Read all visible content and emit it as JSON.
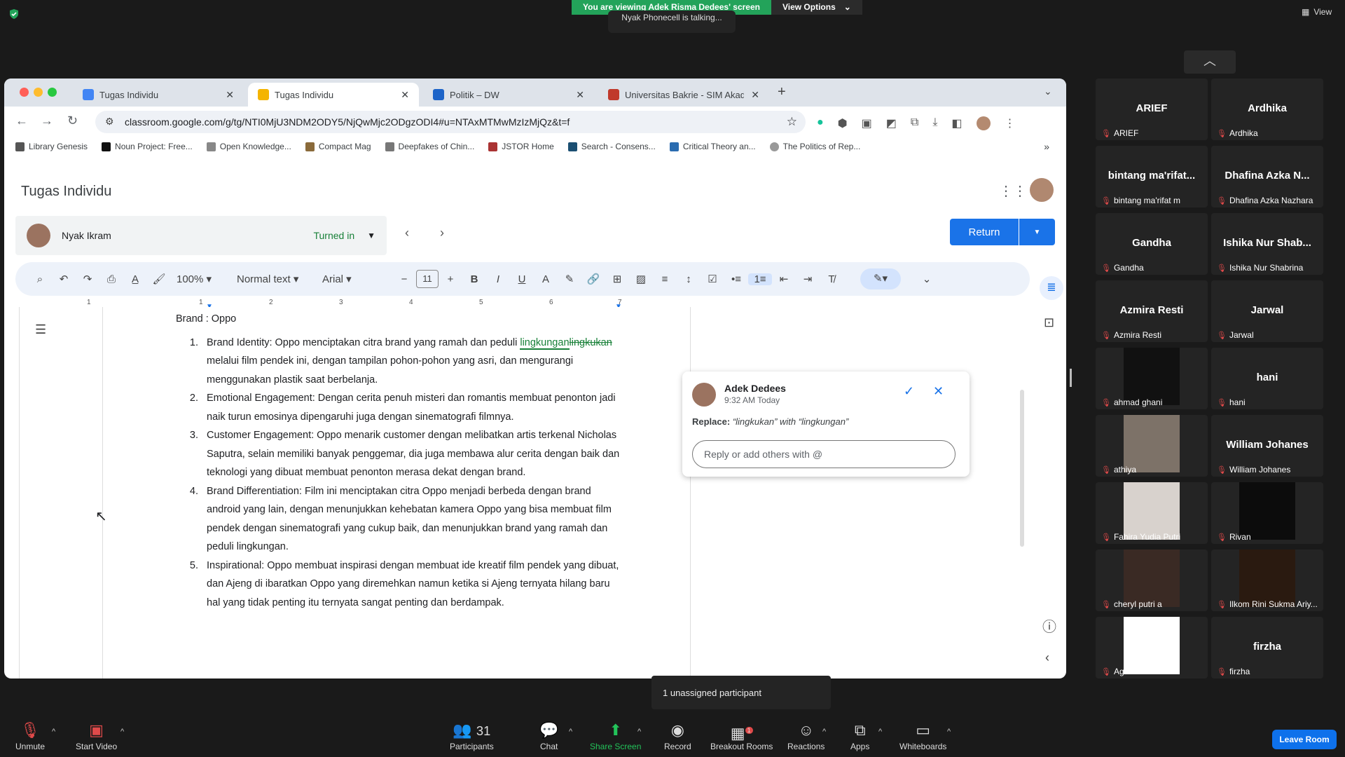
{
  "zoom": {
    "banner_text": "You are viewing Adek Risma Dedees' screen",
    "view_options": "View Options",
    "talking": "Nyak Phonecell is talking...",
    "view": "View",
    "unassigned": "1 unassigned participant",
    "leave": "Leave Room",
    "participants_count": "31",
    "breakout_badge": "1",
    "bottom": {
      "unmute": "Unmute",
      "start_video": "Start Video",
      "participants": "Participants",
      "chat": "Chat",
      "share": "Share Screen",
      "record": "Record",
      "breakout": "Breakout Rooms",
      "reactions": "Reactions",
      "apps": "Apps",
      "whiteboards": "Whiteboards"
    },
    "tiles": [
      {
        "name": "ARIEF",
        "label": "ARIEF",
        "video": false
      },
      {
        "name": "Ardhika",
        "label": "Ardhika",
        "video": false
      },
      {
        "name": "bintang  ma'rifat...",
        "label": "bintang ma'rifat m",
        "video": false
      },
      {
        "name": "Dhafina Azka N...",
        "label": "Dhafina Azka Nazhara",
        "video": false
      },
      {
        "name": "Gandha",
        "label": "Gandha",
        "video": false
      },
      {
        "name": "Ishika Nur Shab...",
        "label": "Ishika Nur Shabrina",
        "video": false
      },
      {
        "name": "Azmira Resti",
        "label": "Azmira Resti",
        "video": false
      },
      {
        "name": "Jarwal",
        "label": "Jarwal",
        "video": false
      },
      {
        "name": "",
        "label": "ahmad ghani",
        "video": true,
        "color": "#111"
      },
      {
        "name": "hani",
        "label": "hani",
        "video": false
      },
      {
        "name": "",
        "label": "athiya",
        "video": true,
        "color": "#7d7268"
      },
      {
        "name": "William Johanes",
        "label": "William Johanes",
        "video": false
      },
      {
        "name": "",
        "label": "Fahira Yudia Putri",
        "video": true,
        "color": "#d8d2cd"
      },
      {
        "name": "",
        "label": "Rivan",
        "video": true,
        "color": "#0c0c0c"
      },
      {
        "name": "",
        "label": "cheryl putri a",
        "video": true,
        "color": "#3a2a24"
      },
      {
        "name": "",
        "label": "Ilkom Rini Sukma Ariy...",
        "video": true,
        "color": "#2a1a10"
      },
      {
        "name": "",
        "label": "Agie Satria",
        "video": true,
        "color": "#ffffff"
      },
      {
        "name": "firzha",
        "label": "firzha",
        "video": false
      }
    ]
  },
  "browser": {
    "tabs": [
      {
        "label": "Tugas Individu",
        "color": "#4285f4"
      },
      {
        "label": "Tugas Individu",
        "color": "#f4b400"
      },
      {
        "label": "Politik – DW",
        "color": "#1d64c8"
      },
      {
        "label": "Universitas Bakrie - SIM Akad",
        "color": "#c0392b"
      }
    ],
    "url": "classroom.google.com/g/tg/NTI0MjU3NDM2ODY5/NjQwMjc2ODgzODI4#u=NTAxMTMwMzIzMjQz&t=f",
    "bookmarks": [
      "Library Genesis",
      "Noun Project: Free...",
      "Open Knowledge...",
      "Compact Mag",
      "Deepfakes of Chin...",
      "JSTOR Home",
      "Search - Consens...",
      "Critical Theory an...",
      "The Politics of Rep..."
    ]
  },
  "classroom": {
    "title": "Tugas Individu",
    "student": "Nyak Ikram",
    "status": "Turned in",
    "return": "Return"
  },
  "docs": {
    "zoom": "100%",
    "style": "Normal text",
    "font": "Arial",
    "size": "11",
    "ruler": [
      "1",
      "1",
      "2",
      "3",
      "4",
      "5",
      "6",
      "7"
    ],
    "heading": "Brand : Oppo",
    "items": [
      {
        "a": "Brand Identity: Oppo menciptakan citra brand yang ramah dan peduli ",
        "ins": "lingkungan",
        "del": "lingkukan",
        "b": " melalui film pendek ini, dengan tampilan pohon-pohon yang asri, dan mengurangi menggunakan plastik saat berbelanja."
      },
      {
        "a": "Emotional Engagement: Dengan cerita penuh misteri dan romantis membuat penonton jadi naik turun emosinya dipengaruhi juga dengan sinematografi filmnya."
      },
      {
        "a": "Customer Engagement: Oppo menarik customer dengan melibatkan artis terkenal Nicholas Saputra, selain memiliki banyak penggemar, dia juga membawa alur cerita dengan baik dan teknologi yang dibuat membuat penonton merasa dekat dengan brand."
      },
      {
        "a": "Brand Differentiation: Film ini menciptakan citra Oppo menjadi berbeda dengan brand android yang lain, dengan menunjukkan kehebatan kamera Oppo yang bisa membuat film pendek dengan sinematografi yang cukup baik, dan menunjukkan brand yang ramah dan peduli lingkungan."
      },
      {
        "a": "Inspirational: Oppo membuat inspirasi dengan membuat ide kreatif film pendek yang dibuat, dan Ajeng di ibaratkan Oppo yang diremehkan namun ketika si Ajeng ternyata hilang baru hal yang tidak penting itu ternyata sangat penting dan berdampak."
      }
    ],
    "comment": {
      "author": "Adek Dedees",
      "time": "9:32 AM Today",
      "replace_label": "Replace:",
      "replace_text": "“lingkukan” with “lingkungan”",
      "placeholder": "Reply or add others with @"
    }
  }
}
